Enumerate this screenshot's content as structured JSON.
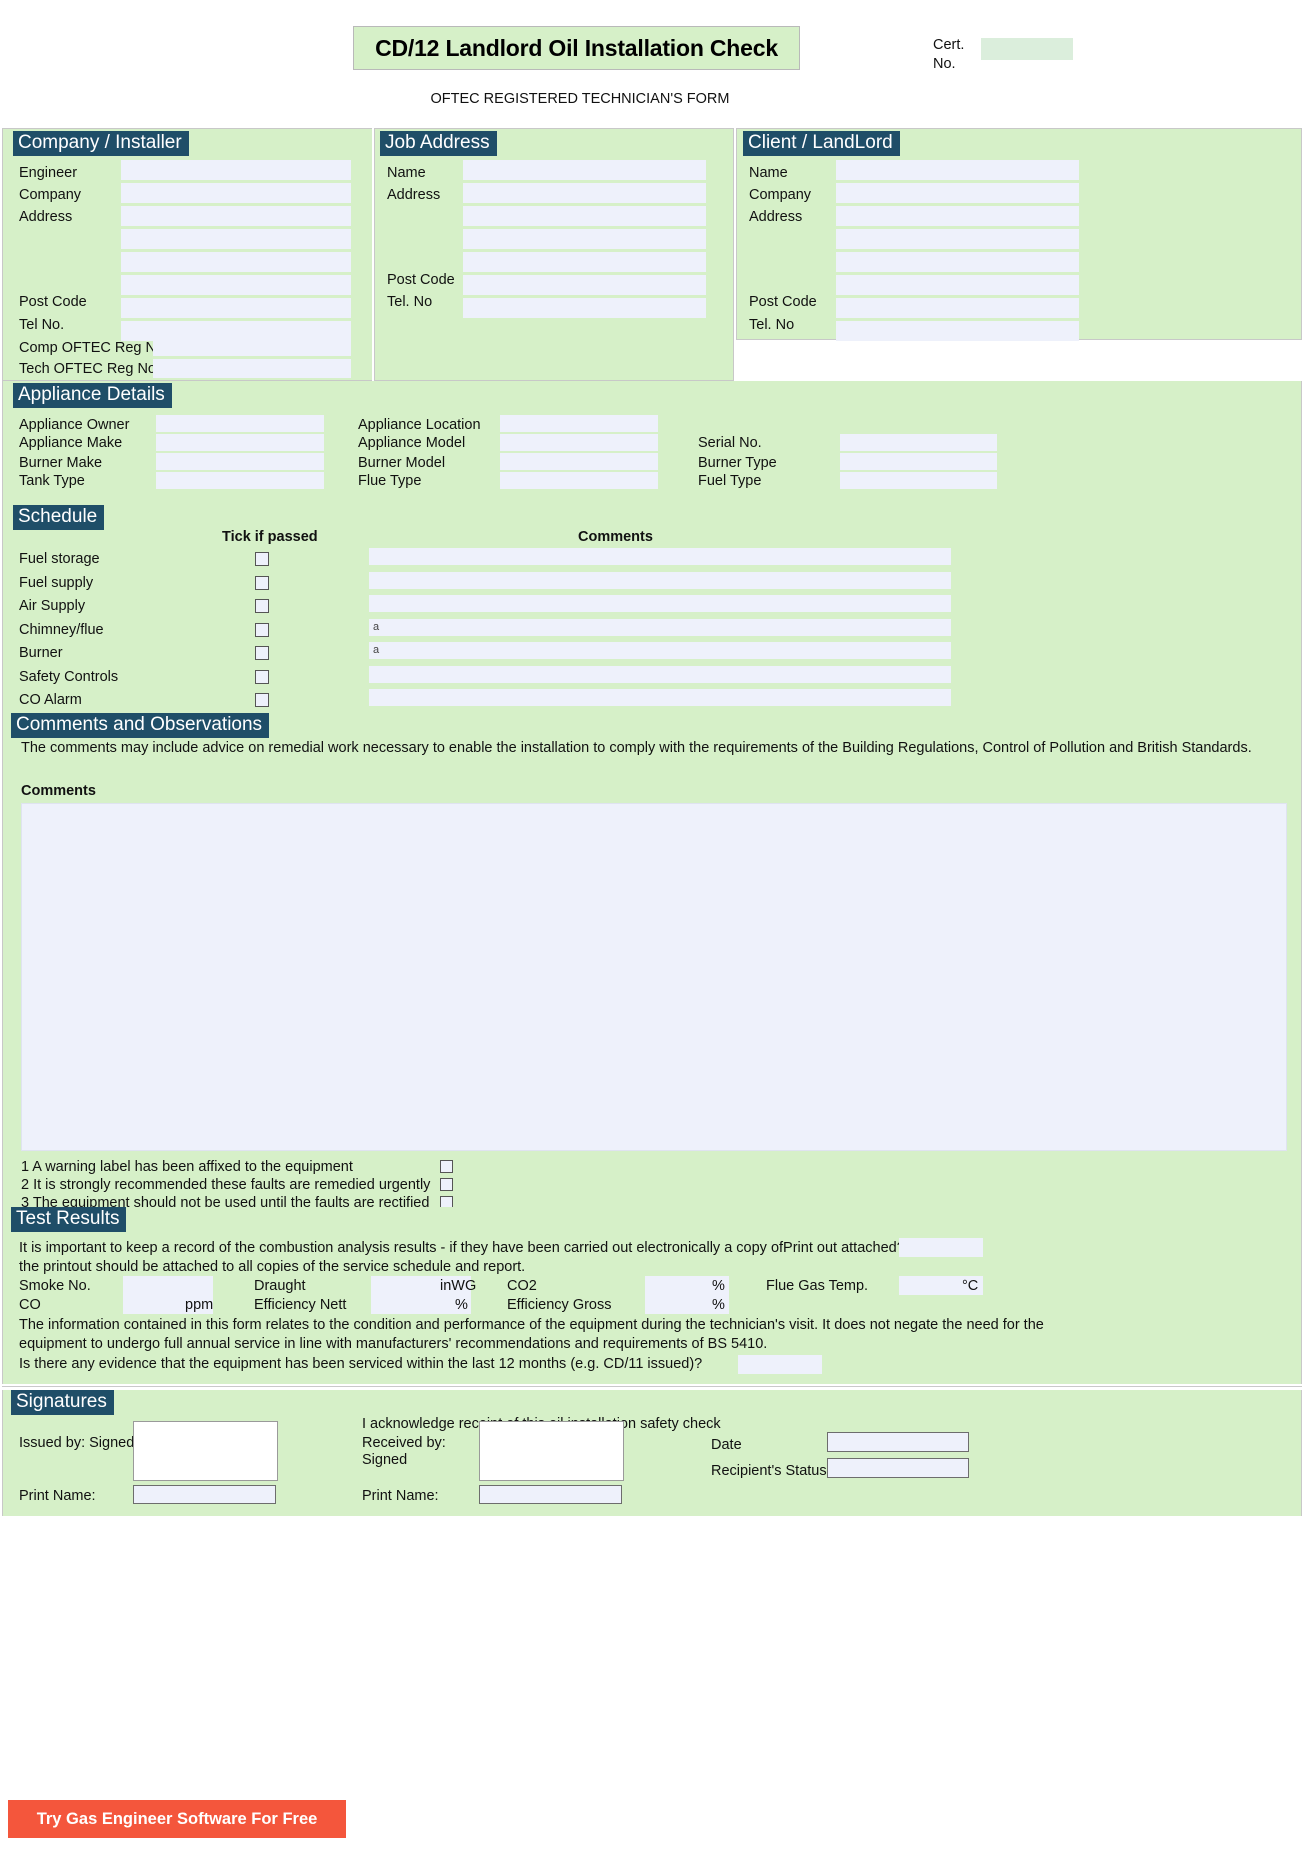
{
  "header": {
    "title": "CD/12 Landlord Oil Installation Check",
    "subtitle": "OFTEC REGISTERED TECHNICIAN'S FORM",
    "cert_label_line1": "Cert.",
    "cert_label_line2": "No.",
    "cert_value": ""
  },
  "company": {
    "heading": "Company / Installer",
    "labels": [
      "Engineer",
      "Company",
      "Address",
      "Post Code",
      "Tel No.",
      "Comp OFTEC Reg No.",
      "Tech OFTEC Reg No."
    ],
    "values": [
      "",
      "",
      "",
      "",
      "",
      "",
      "",
      "",
      "",
      ""
    ]
  },
  "job_address": {
    "heading": "Job Address",
    "labels": [
      "Name",
      "Address",
      "Post Code",
      "Tel. No"
    ],
    "values": [
      "",
      "",
      "",
      "",
      "",
      "",
      ""
    ]
  },
  "client": {
    "heading": "Client / LandLord",
    "labels": [
      "Name",
      "Company",
      "Address",
      "Post Code",
      "Tel. No"
    ],
    "values": [
      "",
      "",
      "",
      "",
      "",
      "",
      "",
      ""
    ]
  },
  "appliance": {
    "heading": "Appliance Details",
    "col1": [
      "Appliance Owner",
      "Appliance Make",
      "Burner Make",
      "Tank Type"
    ],
    "col2": [
      "Appliance Location",
      "Appliance Model",
      "Burner Model",
      "Flue Type"
    ],
    "col3": [
      "Serial No.",
      "Burner Type",
      "Fuel Type"
    ],
    "values1": [
      "",
      "",
      "",
      ""
    ],
    "values2": [
      "",
      "",
      "",
      ""
    ],
    "values3": [
      "",
      "",
      ""
    ]
  },
  "schedule": {
    "heading": "Schedule",
    "col_tick": "Tick if passed",
    "col_comments": "Comments",
    "rows": [
      {
        "label": "Fuel storage",
        "ticked": false,
        "comment": ""
      },
      {
        "label": "Fuel supply",
        "ticked": false,
        "comment": ""
      },
      {
        "label": "Air Supply",
        "ticked": false,
        "comment": ""
      },
      {
        "label": "Chimney/flue",
        "ticked": false,
        "comment": "a"
      },
      {
        "label": "Burner",
        "ticked": false,
        "comment": "a"
      },
      {
        "label": "Safety Controls",
        "ticked": false,
        "comment": ""
      },
      {
        "label": "CO Alarm",
        "ticked": false,
        "comment": ""
      }
    ]
  },
  "comments_section": {
    "heading": "Comments and Observations",
    "intro": "The comments may include advice on remedial work necessary to enable the installation to comply with the requirements of the Building Regulations, Control of Pollution and British Standards.",
    "comments_label": "Comments",
    "comments_value": "",
    "warnings": [
      {
        "text": "1 A warning label has been affixed to the equipment",
        "ticked": false
      },
      {
        "text": "2 It is strongly recommended these faults are remedied urgently",
        "ticked": false
      },
      {
        "text": "3 The equipment should not be used until the faults are rectified",
        "ticked": false
      }
    ]
  },
  "test_results": {
    "heading": "Test Results",
    "intro_line1": "It is important to keep a record of the combustion analysis results - if they have been carried out electronically a copy ofPrint out attached?",
    "intro_line2": "the printout should be attached to all copies of the service schedule and report.",
    "printout_value": "",
    "smoke_label": "Smoke No.",
    "smoke_value": "",
    "draught_label": "Draught",
    "draught_value": "",
    "draught_unit": "inWG",
    "co2_label": "CO2",
    "co2_value": "",
    "co2_unit": "%",
    "flue_temp_label": "Flue Gas Temp.",
    "flue_temp_value": "",
    "flue_temp_unit": "°C",
    "co_label": "CO",
    "co_value": "",
    "co_unit": "ppm",
    "eff_nett_label": "Efficiency Nett",
    "eff_nett_value": "",
    "eff_nett_unit": "%",
    "eff_gross_label": "Efficiency Gross",
    "eff_gross_value": "",
    "eff_gross_unit": "%",
    "disclaimer_line1": "The information contained in this form relates to the condition and performance of the equipment during the technician's visit. It does not negate the need for the",
    "disclaimer_line2": "equipment to undergo full annual service in line with manufacturers' recommendations and requirements of BS 5410.",
    "serviced_question": "Is there any evidence that the equipment has been serviced within the last 12 months (e.g. CD/11 issued)?",
    "serviced_value": ""
  },
  "signatures": {
    "heading": "Signatures",
    "acknowledge": "I acknowledge receipt of this oil installation safety check",
    "issued_label": "Issued by: Signed",
    "issued_signature": "",
    "issued_print_label": "Print Name:",
    "issued_print_value": "",
    "received_label_line1": "Received by:",
    "received_label_line2": "Signed",
    "received_signature": "",
    "received_print_label": "Print Name:",
    "received_print_value": "",
    "date_label": "Date",
    "date_value": "",
    "status_label": "Recipient's Status",
    "status_value": ""
  },
  "cta": {
    "label": "Try Gas Engineer Software For Free"
  },
  "colors": {
    "panel_green": "#d6f0c8",
    "heading_navy": "#1f4e68",
    "field_blue": "#eef1fb",
    "cta_orange": "#f4563c"
  }
}
